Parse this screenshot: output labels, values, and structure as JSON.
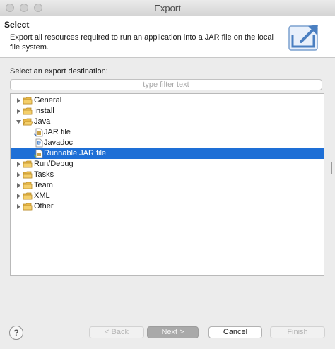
{
  "window": {
    "title": "Export"
  },
  "header": {
    "title": "Select",
    "description": "Export all resources required to run an application into a JAR file on the local file system."
  },
  "destination_label": "Select an export destination:",
  "filter": {
    "placeholder": "type filter text",
    "value": ""
  },
  "tree": [
    {
      "label": "General",
      "type": "folder",
      "expanded": false
    },
    {
      "label": "Install",
      "type": "folder",
      "expanded": false
    },
    {
      "label": "Java",
      "type": "folder",
      "expanded": true
    },
    {
      "label": "JAR file",
      "type": "jar",
      "selected": false
    },
    {
      "label": "Javadoc",
      "type": "javadoc",
      "selected": false
    },
    {
      "label": "Runnable JAR file",
      "type": "runnable-jar",
      "selected": true
    },
    {
      "label": "Run/Debug",
      "type": "folder",
      "expanded": false
    },
    {
      "label": "Tasks",
      "type": "folder",
      "expanded": false
    },
    {
      "label": "Team",
      "type": "folder",
      "expanded": false
    },
    {
      "label": "XML",
      "type": "folder",
      "expanded": false
    },
    {
      "label": "Other",
      "type": "folder",
      "expanded": false
    }
  ],
  "buttons": {
    "help": "?",
    "back": "< Back",
    "next": "Next >",
    "cancel": "Cancel",
    "finish": "Finish"
  },
  "colors": {
    "selection": "#1e6fd6",
    "folder": "#e9b949"
  }
}
